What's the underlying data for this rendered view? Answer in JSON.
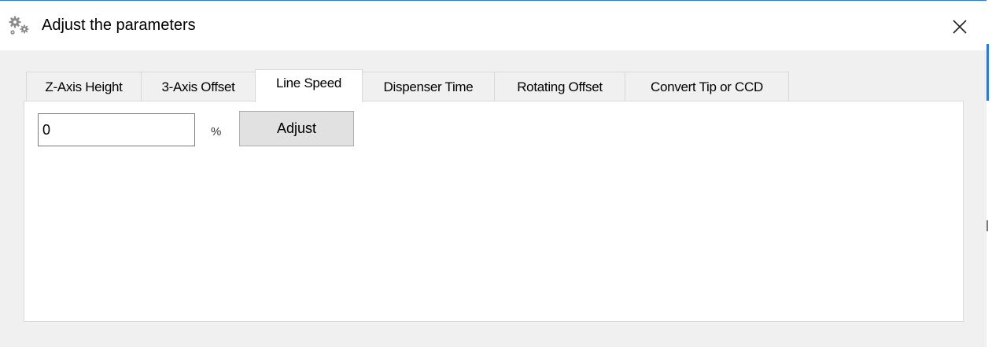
{
  "window": {
    "title": "Adjust the parameters",
    "icon": "gears-icon",
    "close_icon": "close-icon"
  },
  "tabs": [
    {
      "label": "Z-Axis Height",
      "active": false
    },
    {
      "label": "3-Axis Offset",
      "active": false
    },
    {
      "label": "Line Speed",
      "active": true
    },
    {
      "label": "Dispenser Time",
      "active": false
    },
    {
      "label": "Rotating Offset",
      "active": false
    },
    {
      "label": "Convert Tip or CCD",
      "active": false
    }
  ],
  "line_speed": {
    "value": "0",
    "unit": "%",
    "adjust_label": "Adjust"
  },
  "colors": {
    "accent": "#2b7bd6",
    "window_bg": "#f0f0f0",
    "button_bg": "#e1e1e1"
  }
}
